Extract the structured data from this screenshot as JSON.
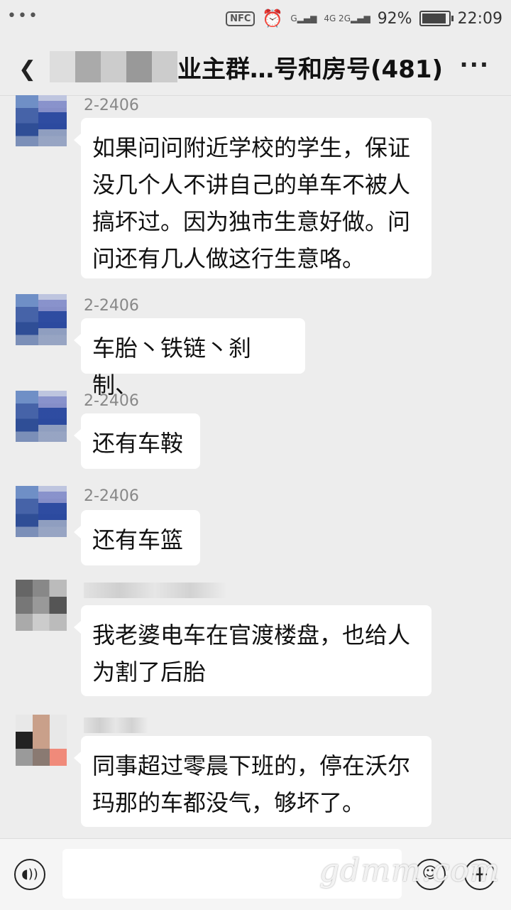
{
  "status_bar": {
    "dots": "•••",
    "nfc": "NFC",
    "sig1": "G",
    "sig2": "4G 2G",
    "battery_pct": "92%",
    "battery_level": 0.92,
    "time": "22:09"
  },
  "header": {
    "title": "业主群…号和房号(481)",
    "back_icon": "back-chevron-icon",
    "more_icon": "more-icon",
    "more_label": "···"
  },
  "messages": [
    {
      "sender": "2-2406",
      "text": "如果问问附近学校的学生，保证没几个人不讲自己的单车不被人搞坏过。因为独市生意好做。问问还有几人做这行生意咯。"
    },
    {
      "sender": "2-2406",
      "text": "车胎丶铁链丶刹制、"
    },
    {
      "sender": "2-2406",
      "text": "还有车鞍"
    },
    {
      "sender": "2-2406",
      "text": "还有车篮"
    },
    {
      "sender": "",
      "text": "我老婆电车在官渡楼盘，也给人为割了后胎"
    },
    {
      "sender": "",
      "text": "同事超过零晨下班的，停在沃尔玛那的车都没气，够坏了。"
    }
  ],
  "input_bar": {
    "voice_icon": "voice-icon",
    "voice_glyph": "◖))",
    "emoji_icon": "emoji-icon",
    "emoji_glyph": "☺",
    "plus_icon": "plus-icon",
    "plus_glyph": "+"
  },
  "watermark": "gdmm.com"
}
